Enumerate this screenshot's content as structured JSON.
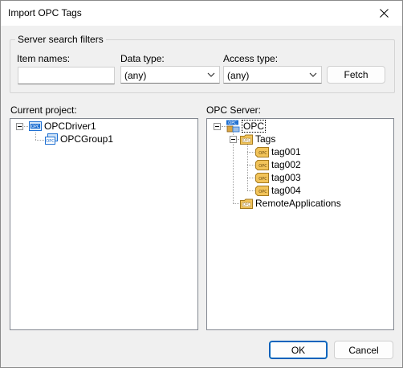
{
  "window": {
    "title": "Import OPC Tags",
    "close_icon": "close-icon"
  },
  "filters": {
    "group_title": "Server search filters",
    "item_names_label": "Item names:",
    "item_names_value": "",
    "data_type_label": "Data type:",
    "data_type_value": "(any)",
    "access_type_label": "Access type:",
    "access_type_value": "(any)",
    "fetch_label": "Fetch"
  },
  "current_project": {
    "label": "Current project:",
    "nodes": [
      {
        "label": "OPCDriver1",
        "icon": "opc-driver-icon"
      },
      {
        "label": "OPCGroup1",
        "icon": "opc-group-icon"
      }
    ]
  },
  "opc_server": {
    "label": "OPC Server:",
    "root": {
      "label": "OPC",
      "icon": "opc-server-icon"
    },
    "tags_folder": {
      "label": "Tags",
      "icon": "opc-folder-icon"
    },
    "tags": [
      "tag001",
      "tag002",
      "tag003",
      "tag004"
    ],
    "remote_folder": {
      "label": "RemoteApplications",
      "icon": "opc-folder-icon"
    }
  },
  "footer": {
    "ok_label": "OK",
    "cancel_label": "Cancel"
  },
  "colors": {
    "accent": "#0067c0",
    "icon_blue": "#1e6fd1",
    "icon_gold": "#d9a441"
  }
}
